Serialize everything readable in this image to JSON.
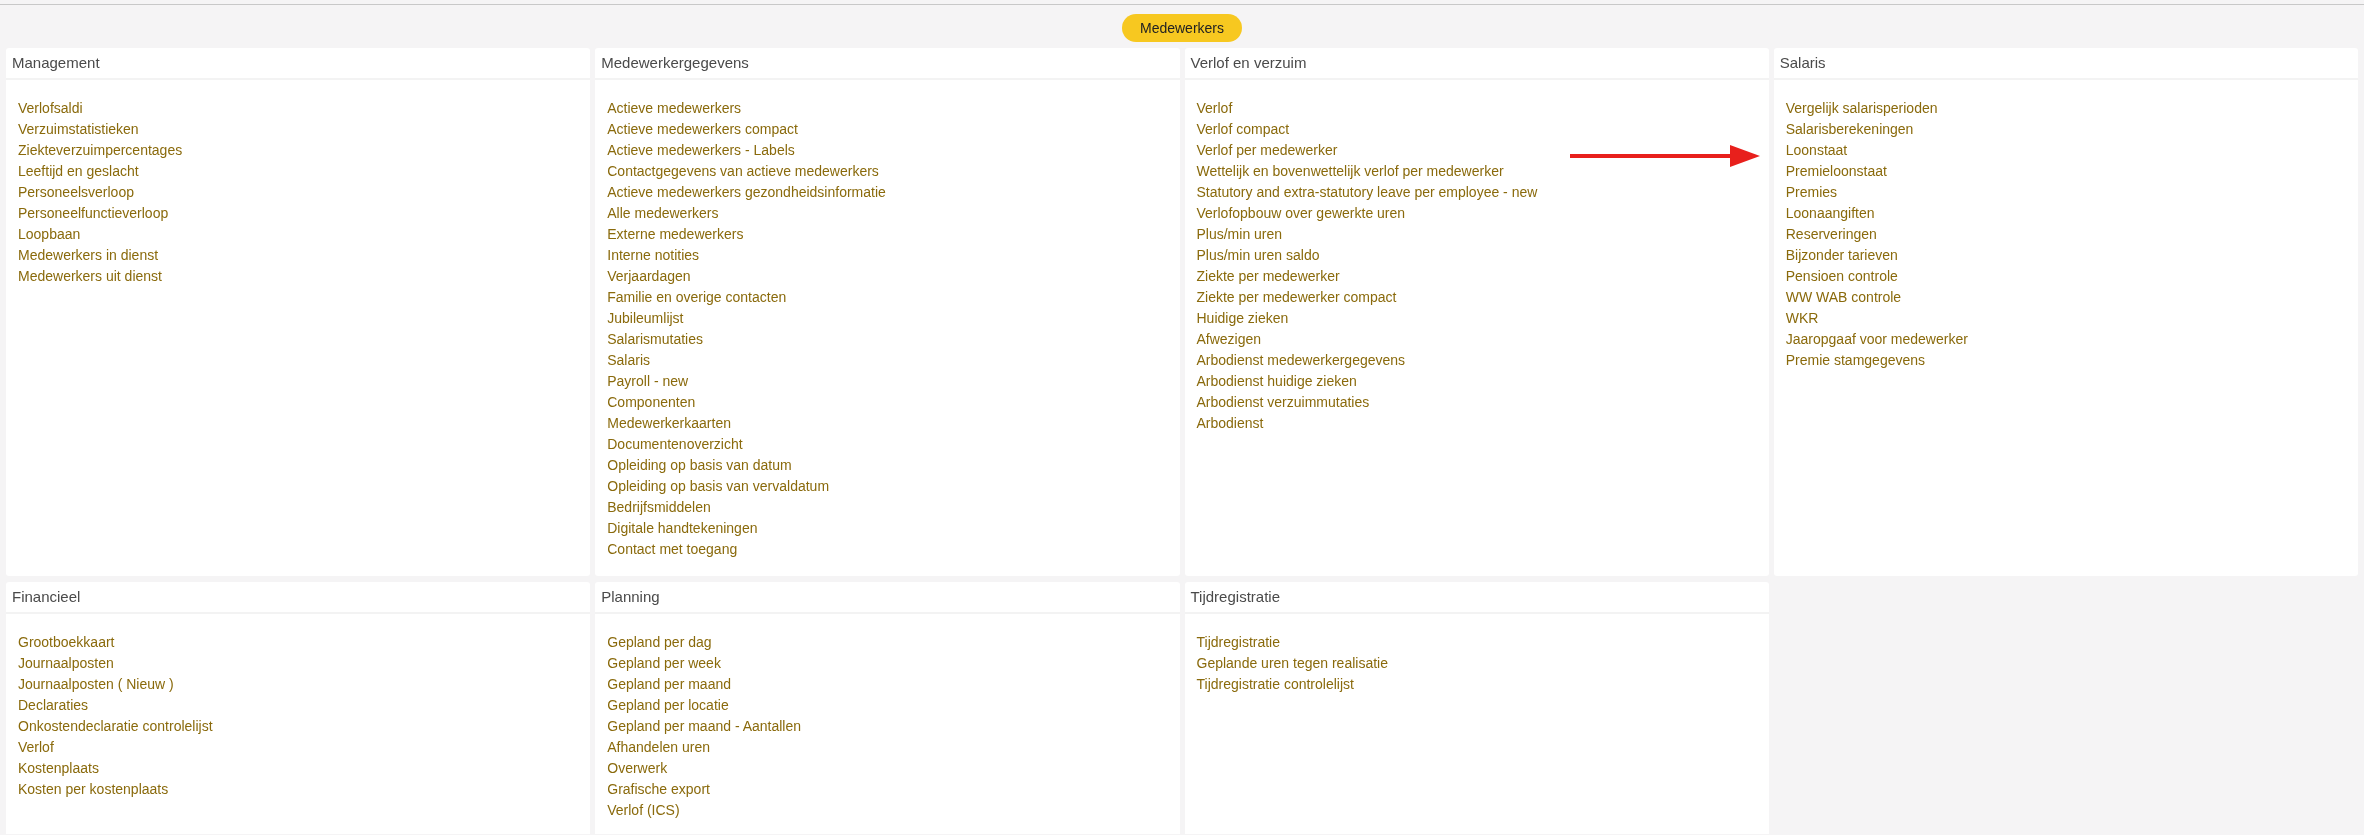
{
  "header": {
    "button": "Medewerkers"
  },
  "sections": [
    {
      "title": "Management",
      "items": [
        "Verlofsaldi",
        "Verzuimstatistieken",
        "Ziekteverzuimpercentages",
        "Leeftijd en geslacht",
        "Personeelsverloop",
        "Personeelfunctieverloop",
        "Loopbaan",
        "Medewerkers in dienst",
        "Medewerkers uit dienst"
      ]
    },
    {
      "title": "Medewerkergegevens",
      "items": [
        "Actieve medewerkers",
        "Actieve medewerkers compact",
        "Actieve medewerkers - Labels",
        "Contactgegevens van actieve medewerkers",
        "Actieve medewerkers gezondheidsinformatie",
        "Alle medewerkers",
        "Externe medewerkers",
        "Interne notities",
        "Verjaardagen",
        "Familie en overige contacten",
        "Jubileumlijst",
        "Salarismutaties",
        "Salaris",
        "Payroll - new",
        "Componenten",
        "Medewerkerkaarten",
        "Documentenoverzicht",
        "Opleiding op basis van datum",
        "Opleiding op basis van vervaldatum",
        "Bedrijfsmiddelen",
        "Digitale handtekeningen",
        "Contact met toegang"
      ]
    },
    {
      "title": "Verlof en verzuim",
      "items": [
        "Verlof",
        "Verlof compact",
        "Verlof per medewerker",
        "Wettelijk en bovenwettelijk verlof per medewerker",
        "Statutory and extra-statutory leave per employee - new",
        "Verlofopbouw over gewerkte uren",
        "Plus/min uren",
        "Plus/min uren saldo",
        "Ziekte per medewerker",
        "Ziekte per medewerker compact",
        "Huidige zieken",
        "Afwezigen",
        "Arbodienst medewerkergegevens",
        "Arbodienst huidige zieken",
        "Arbodienst verzuimmutaties",
        "Arbodienst"
      ]
    },
    {
      "title": "Salaris",
      "items": [
        "Vergelijk salarisperioden",
        "Salarisberekeningen",
        "Loonstaat",
        "Premieloonstaat",
        "Premies",
        "Loonaangiften",
        "Reserveringen",
        "Bijzonder tarieven",
        "Pensioen controle",
        "WW WAB controle",
        "WKR",
        "Jaaropgaaf voor medewerker",
        "Premie stamgegevens"
      ]
    },
    {
      "title": "Financieel",
      "items": [
        "Grootboekkaart",
        "Journaalposten",
        "Journaalposten ( Nieuw )",
        "Declaraties",
        "Onkostendeclaratie controlelijst",
        "Verlof",
        "Kostenplaats",
        "Kosten per kostenplaats"
      ]
    },
    {
      "title": "Planning",
      "items": [
        "Gepland per dag",
        "Gepland per week",
        "Gepland per maand",
        "Gepland per locatie",
        "Gepland per maand - Aantallen",
        "Afhandelen uren",
        "Overwerk",
        "Grafische export",
        "Verlof (ICS)"
      ]
    },
    {
      "title": "Tijdregistratie",
      "items": [
        "Tijdregistratie",
        "Geplande uren tegen realisatie",
        "Tijdregistratie controlelijst"
      ]
    }
  ]
}
